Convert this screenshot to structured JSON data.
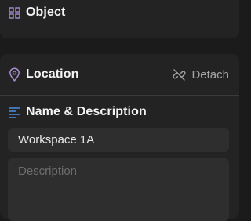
{
  "object_section": {
    "title": "Object",
    "icon": "grid-icon",
    "accent_color": "#a88ed6"
  },
  "location_section": {
    "title": "Location",
    "icon": "map-pin-icon",
    "accent_color": "#a88ed6",
    "detach_label": "Detach",
    "detach_icon": "unlink-icon"
  },
  "name_description_section": {
    "title": "Name & Description",
    "icon": "align-left-icon",
    "accent_color": "#4a90e2",
    "name_value": "Workspace 1A",
    "description_placeholder": "Description"
  }
}
